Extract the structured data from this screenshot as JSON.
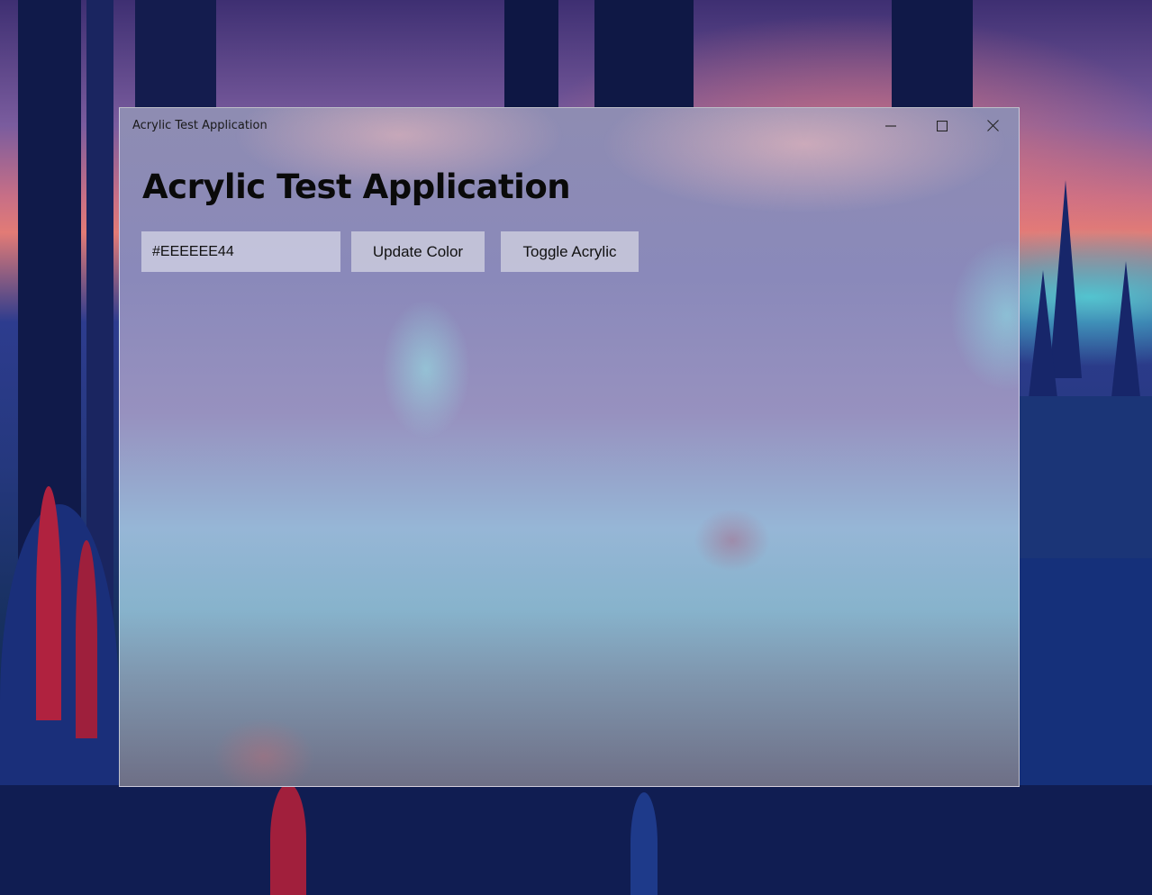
{
  "window": {
    "title": "Acrylic Test Application",
    "controls": {
      "minimize": "minimize-icon",
      "maximize": "maximize-icon",
      "close": "close-icon"
    }
  },
  "main": {
    "heading": "Acrylic Test Application",
    "color_input": {
      "value": "#EEEEEE44",
      "placeholder": ""
    },
    "buttons": {
      "update_color": "Update Color",
      "toggle_acrylic": "Toggle Acrylic"
    }
  },
  "colors": {
    "text": "#111111",
    "control_background": "#CDCDDE"
  }
}
